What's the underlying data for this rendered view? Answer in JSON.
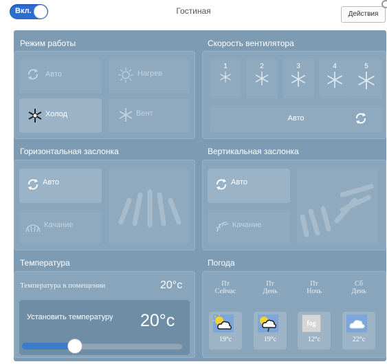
{
  "topbar": {
    "power_label": "Вкл.",
    "room_title": "Гостиная",
    "actions_label": "Действия"
  },
  "mode": {
    "title": "Режим работы",
    "auto": "Авто",
    "heat": "Нагрев",
    "cool": "Холод",
    "vent": "Вент"
  },
  "fan": {
    "title": "Скорость вентилятора",
    "speeds": [
      "1",
      "2",
      "3",
      "4",
      "5"
    ],
    "auto": "Авто"
  },
  "hflap": {
    "title": "Горизонтальная заслонка",
    "auto": "Авто",
    "swing": "Качание"
  },
  "vflap": {
    "title": "Вертикальная заслонка",
    "auto": "Авто",
    "swing": "Качание"
  },
  "temperature": {
    "title": "Температура",
    "room_label": "Температура в помещении",
    "room_value": "20°c",
    "set_label": "Установить температуру",
    "set_value": "20°c",
    "slider_level": 0.33
  },
  "weather": {
    "title": "Погода",
    "columns": [
      {
        "day": "Пт",
        "period": "Сейчас",
        "temp": "19°c",
        "icon": "partly-cloudy-icon"
      },
      {
        "day": "Пт",
        "period": "День",
        "temp": "19°c",
        "icon": "partly-cloudy-rain-icon"
      },
      {
        "day": "Пт",
        "period": "Ночь",
        "temp": "12°c",
        "icon": "fog-icon",
        "icon_text": "fog"
      },
      {
        "day": "Сб",
        "period": "День",
        "temp": "22°c",
        "icon": "cloud-icon"
      }
    ]
  },
  "colors": {
    "accent": "#2b6ed0",
    "panel": "#7d9cb4",
    "tile": "#8faabf"
  }
}
